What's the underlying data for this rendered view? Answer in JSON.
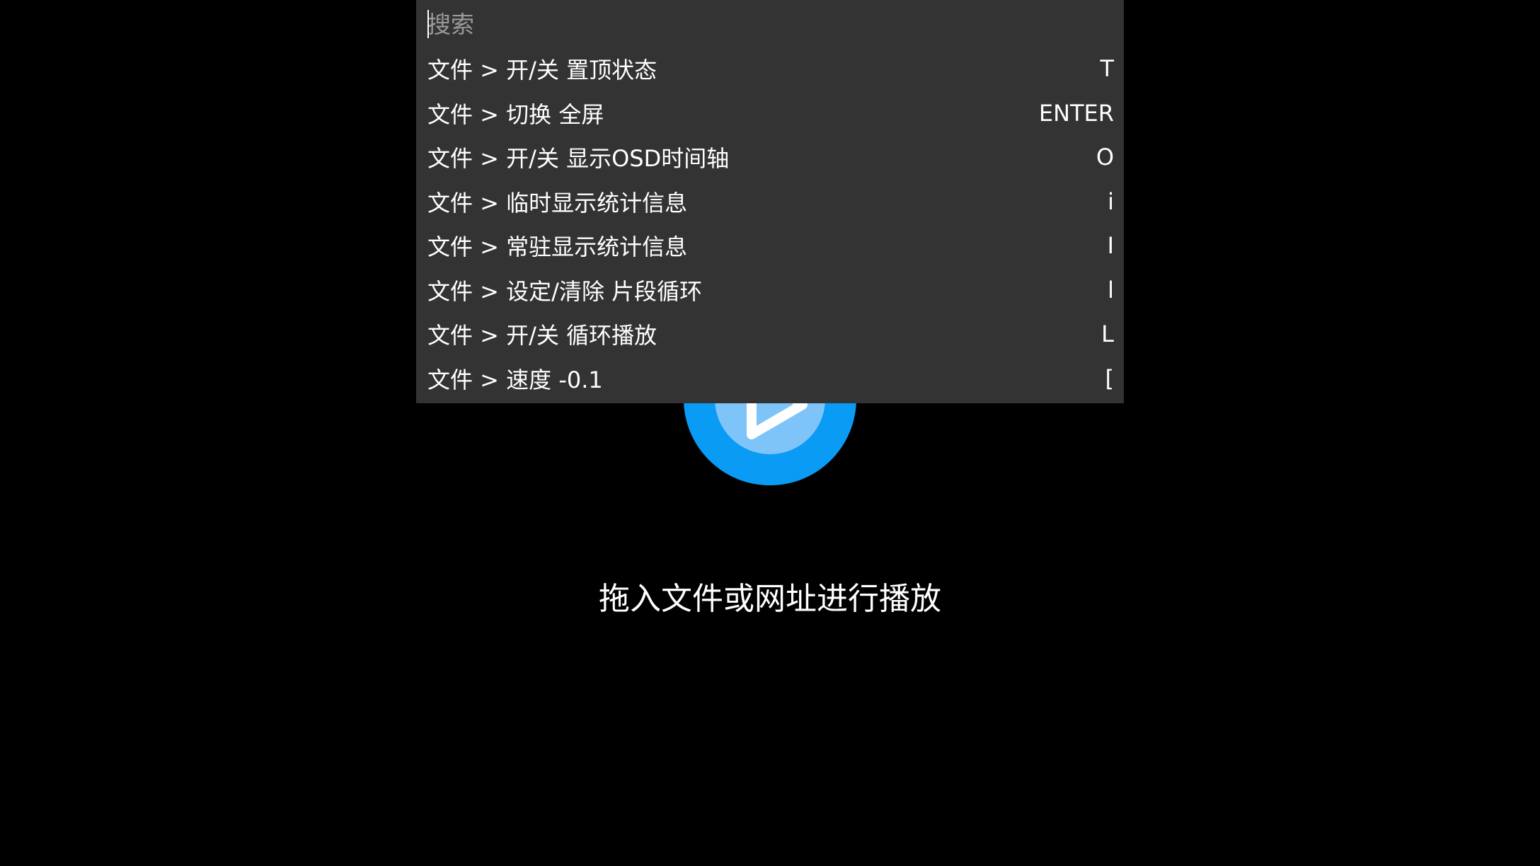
{
  "search": {
    "placeholder": "搜索",
    "value": ""
  },
  "menu": {
    "items": [
      {
        "label": "文件 > 开/关 置顶状态",
        "shortcut": "T"
      },
      {
        "label": "文件 > 切换 全屏",
        "shortcut": "ENTER"
      },
      {
        "label": "文件 > 开/关 显示OSD时间轴",
        "shortcut": "O"
      },
      {
        "label": "文件 > 临时显示统计信息",
        "shortcut": "i"
      },
      {
        "label": "文件 > 常驻显示统计信息",
        "shortcut": "I"
      },
      {
        "label": "文件 > 设定/清除 片段循环",
        "shortcut": "l"
      },
      {
        "label": "文件 > 开/关 循环播放",
        "shortcut": "L"
      },
      {
        "label": "文件 > 速度 -0.1",
        "shortcut": "["
      }
    ]
  },
  "main": {
    "drop_hint": "拖入文件或网址进行播放",
    "logo_icon": "play-logo-icon"
  },
  "colors": {
    "background": "#000000",
    "palette_bg": "#333333",
    "logo_outer": "#0a9bf5",
    "logo_inner": "#7fc4f8",
    "text": "#ffffff",
    "placeholder": "#9a9a9a"
  }
}
